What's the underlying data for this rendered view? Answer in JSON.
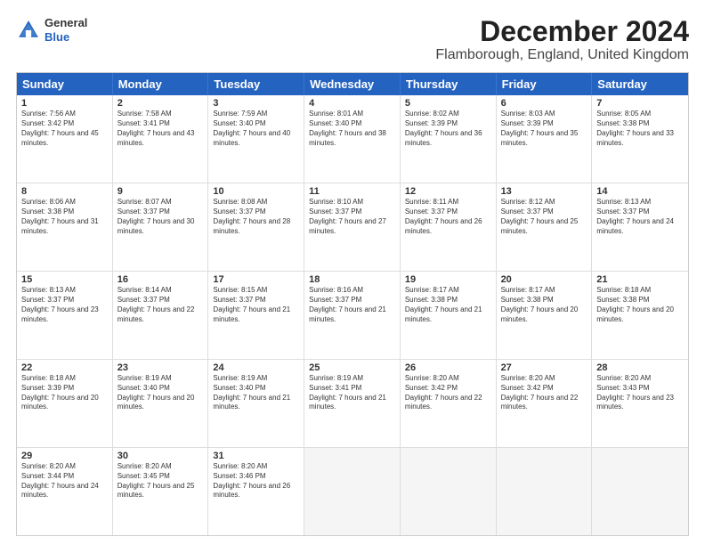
{
  "header": {
    "logo_general": "General",
    "logo_blue": "Blue",
    "month_title": "December 2024",
    "subtitle": "Flamborough, England, United Kingdom"
  },
  "weekdays": [
    "Sunday",
    "Monday",
    "Tuesday",
    "Wednesday",
    "Thursday",
    "Friday",
    "Saturday"
  ],
  "rows": [
    [
      {
        "day": "1",
        "sunrise": "Sunrise: 7:56 AM",
        "sunset": "Sunset: 3:42 PM",
        "daylight": "Daylight: 7 hours and 45 minutes."
      },
      {
        "day": "2",
        "sunrise": "Sunrise: 7:58 AM",
        "sunset": "Sunset: 3:41 PM",
        "daylight": "Daylight: 7 hours and 43 minutes."
      },
      {
        "day": "3",
        "sunrise": "Sunrise: 7:59 AM",
        "sunset": "Sunset: 3:40 PM",
        "daylight": "Daylight: 7 hours and 40 minutes."
      },
      {
        "day": "4",
        "sunrise": "Sunrise: 8:01 AM",
        "sunset": "Sunset: 3:40 PM",
        "daylight": "Daylight: 7 hours and 38 minutes."
      },
      {
        "day": "5",
        "sunrise": "Sunrise: 8:02 AM",
        "sunset": "Sunset: 3:39 PM",
        "daylight": "Daylight: 7 hours and 36 minutes."
      },
      {
        "day": "6",
        "sunrise": "Sunrise: 8:03 AM",
        "sunset": "Sunset: 3:39 PM",
        "daylight": "Daylight: 7 hours and 35 minutes."
      },
      {
        "day": "7",
        "sunrise": "Sunrise: 8:05 AM",
        "sunset": "Sunset: 3:38 PM",
        "daylight": "Daylight: 7 hours and 33 minutes."
      }
    ],
    [
      {
        "day": "8",
        "sunrise": "Sunrise: 8:06 AM",
        "sunset": "Sunset: 3:38 PM",
        "daylight": "Daylight: 7 hours and 31 minutes."
      },
      {
        "day": "9",
        "sunrise": "Sunrise: 8:07 AM",
        "sunset": "Sunset: 3:37 PM",
        "daylight": "Daylight: 7 hours and 30 minutes."
      },
      {
        "day": "10",
        "sunrise": "Sunrise: 8:08 AM",
        "sunset": "Sunset: 3:37 PM",
        "daylight": "Daylight: 7 hours and 28 minutes."
      },
      {
        "day": "11",
        "sunrise": "Sunrise: 8:10 AM",
        "sunset": "Sunset: 3:37 PM",
        "daylight": "Daylight: 7 hours and 27 minutes."
      },
      {
        "day": "12",
        "sunrise": "Sunrise: 8:11 AM",
        "sunset": "Sunset: 3:37 PM",
        "daylight": "Daylight: 7 hours and 26 minutes."
      },
      {
        "day": "13",
        "sunrise": "Sunrise: 8:12 AM",
        "sunset": "Sunset: 3:37 PM",
        "daylight": "Daylight: 7 hours and 25 minutes."
      },
      {
        "day": "14",
        "sunrise": "Sunrise: 8:13 AM",
        "sunset": "Sunset: 3:37 PM",
        "daylight": "Daylight: 7 hours and 24 minutes."
      }
    ],
    [
      {
        "day": "15",
        "sunrise": "Sunrise: 8:13 AM",
        "sunset": "Sunset: 3:37 PM",
        "daylight": "Daylight: 7 hours and 23 minutes."
      },
      {
        "day": "16",
        "sunrise": "Sunrise: 8:14 AM",
        "sunset": "Sunset: 3:37 PM",
        "daylight": "Daylight: 7 hours and 22 minutes."
      },
      {
        "day": "17",
        "sunrise": "Sunrise: 8:15 AM",
        "sunset": "Sunset: 3:37 PM",
        "daylight": "Daylight: 7 hours and 21 minutes."
      },
      {
        "day": "18",
        "sunrise": "Sunrise: 8:16 AM",
        "sunset": "Sunset: 3:37 PM",
        "daylight": "Daylight: 7 hours and 21 minutes."
      },
      {
        "day": "19",
        "sunrise": "Sunrise: 8:17 AM",
        "sunset": "Sunset: 3:38 PM",
        "daylight": "Daylight: 7 hours and 21 minutes."
      },
      {
        "day": "20",
        "sunrise": "Sunrise: 8:17 AM",
        "sunset": "Sunset: 3:38 PM",
        "daylight": "Daylight: 7 hours and 20 minutes."
      },
      {
        "day": "21",
        "sunrise": "Sunrise: 8:18 AM",
        "sunset": "Sunset: 3:38 PM",
        "daylight": "Daylight: 7 hours and 20 minutes."
      }
    ],
    [
      {
        "day": "22",
        "sunrise": "Sunrise: 8:18 AM",
        "sunset": "Sunset: 3:39 PM",
        "daylight": "Daylight: 7 hours and 20 minutes."
      },
      {
        "day": "23",
        "sunrise": "Sunrise: 8:19 AM",
        "sunset": "Sunset: 3:40 PM",
        "daylight": "Daylight: 7 hours and 20 minutes."
      },
      {
        "day": "24",
        "sunrise": "Sunrise: 8:19 AM",
        "sunset": "Sunset: 3:40 PM",
        "daylight": "Daylight: 7 hours and 21 minutes."
      },
      {
        "day": "25",
        "sunrise": "Sunrise: 8:19 AM",
        "sunset": "Sunset: 3:41 PM",
        "daylight": "Daylight: 7 hours and 21 minutes."
      },
      {
        "day": "26",
        "sunrise": "Sunrise: 8:20 AM",
        "sunset": "Sunset: 3:42 PM",
        "daylight": "Daylight: 7 hours and 22 minutes."
      },
      {
        "day": "27",
        "sunrise": "Sunrise: 8:20 AM",
        "sunset": "Sunset: 3:42 PM",
        "daylight": "Daylight: 7 hours and 22 minutes."
      },
      {
        "day": "28",
        "sunrise": "Sunrise: 8:20 AM",
        "sunset": "Sunset: 3:43 PM",
        "daylight": "Daylight: 7 hours and 23 minutes."
      }
    ],
    [
      {
        "day": "29",
        "sunrise": "Sunrise: 8:20 AM",
        "sunset": "Sunset: 3:44 PM",
        "daylight": "Daylight: 7 hours and 24 minutes."
      },
      {
        "day": "30",
        "sunrise": "Sunrise: 8:20 AM",
        "sunset": "Sunset: 3:45 PM",
        "daylight": "Daylight: 7 hours and 25 minutes."
      },
      {
        "day": "31",
        "sunrise": "Sunrise: 8:20 AM",
        "sunset": "Sunset: 3:46 PM",
        "daylight": "Daylight: 7 hours and 26 minutes."
      },
      {
        "day": "",
        "sunrise": "",
        "sunset": "",
        "daylight": ""
      },
      {
        "day": "",
        "sunrise": "",
        "sunset": "",
        "daylight": ""
      },
      {
        "day": "",
        "sunrise": "",
        "sunset": "",
        "daylight": ""
      },
      {
        "day": "",
        "sunrise": "",
        "sunset": "",
        "daylight": ""
      }
    ]
  ]
}
